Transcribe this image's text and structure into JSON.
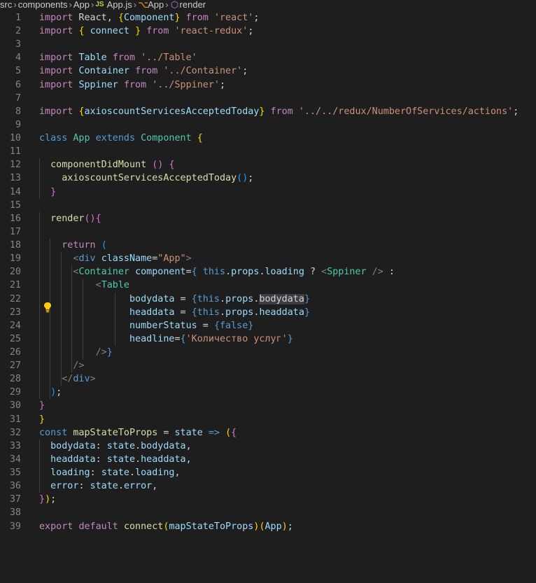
{
  "breadcrumb": {
    "segments": [
      "src",
      "components",
      "App",
      "App.js",
      "App",
      "render"
    ],
    "js_badge": "JS"
  },
  "lines": [
    {
      "n": "1",
      "t": [
        [
          "kw",
          "import"
        ],
        [
          "tx",
          " React, "
        ],
        [
          "br",
          "{"
        ],
        [
          "vr",
          "Component"
        ],
        [
          "br",
          "}"
        ],
        [
          "tx",
          " "
        ],
        [
          "kw",
          "from"
        ],
        [
          "tx",
          " "
        ],
        [
          "s",
          "'react'"
        ],
        [
          "tx",
          ";"
        ]
      ]
    },
    {
      "n": "2",
      "t": [
        [
          "kw",
          "import"
        ],
        [
          "tx",
          " "
        ],
        [
          "br",
          "{"
        ],
        [
          "tx",
          " "
        ],
        [
          "vr",
          "connect"
        ],
        [
          "tx",
          " "
        ],
        [
          "br",
          "}"
        ],
        [
          "tx",
          " "
        ],
        [
          "kw",
          "from"
        ],
        [
          "tx",
          " "
        ],
        [
          "s",
          "'react-redux'"
        ],
        [
          "tx",
          ";"
        ]
      ]
    },
    {
      "n": "3",
      "t": []
    },
    {
      "n": "4",
      "t": [
        [
          "kw",
          "import"
        ],
        [
          "tx",
          " "
        ],
        [
          "vr",
          "Table"
        ],
        [
          "tx",
          " "
        ],
        [
          "kw",
          "from"
        ],
        [
          "tx",
          " "
        ],
        [
          "s",
          "'../Table'"
        ]
      ]
    },
    {
      "n": "5",
      "t": [
        [
          "kw",
          "import"
        ],
        [
          "tx",
          " "
        ],
        [
          "vr",
          "Container"
        ],
        [
          "tx",
          " "
        ],
        [
          "kw",
          "from"
        ],
        [
          "tx",
          " "
        ],
        [
          "s",
          "'../Container'"
        ],
        [
          "tx",
          ";"
        ]
      ]
    },
    {
      "n": "6",
      "t": [
        [
          "kw",
          "import"
        ],
        [
          "tx",
          " "
        ],
        [
          "vr",
          "Sppiner"
        ],
        [
          "tx",
          " "
        ],
        [
          "kw",
          "from"
        ],
        [
          "tx",
          " "
        ],
        [
          "s",
          "'../Sppiner'"
        ],
        [
          "tx",
          ";"
        ]
      ]
    },
    {
      "n": "7",
      "t": []
    },
    {
      "n": "8",
      "t": [
        [
          "kw",
          "import"
        ],
        [
          "tx",
          " "
        ],
        [
          "br",
          "{"
        ],
        [
          "vr",
          "axioscountServicesAcceptedToday"
        ],
        [
          "br",
          "}"
        ],
        [
          "tx",
          " "
        ],
        [
          "kw",
          "from"
        ],
        [
          "tx",
          " "
        ],
        [
          "s",
          "'../../redux/NumberOfServices/actions'"
        ],
        [
          "tx",
          ";"
        ]
      ]
    },
    {
      "n": "9",
      "t": []
    },
    {
      "n": "10",
      "t": [
        [
          "st",
          "class"
        ],
        [
          "tx",
          " "
        ],
        [
          "cl",
          "App"
        ],
        [
          "tx",
          " "
        ],
        [
          "st",
          "extends"
        ],
        [
          "tx",
          " "
        ],
        [
          "cl",
          "Component"
        ],
        [
          "tx",
          " "
        ],
        [
          "br",
          "{"
        ]
      ]
    },
    {
      "n": "11",
      "t": []
    },
    {
      "n": "12",
      "t": [
        [
          "tx",
          "  "
        ],
        [
          "fn",
          "componentDidMount"
        ],
        [
          "tx",
          " "
        ],
        [
          "br2",
          "()"
        ],
        [
          "tx",
          " "
        ],
        [
          "br2",
          "{"
        ]
      ]
    },
    {
      "n": "13",
      "t": [
        [
          "tx",
          "    "
        ],
        [
          "fn",
          "axioscountServicesAcceptedToday"
        ],
        [
          "br3",
          "()"
        ],
        [
          "tx",
          ";"
        ]
      ]
    },
    {
      "n": "14",
      "t": [
        [
          "tx",
          "  "
        ],
        [
          "br2",
          "}"
        ]
      ]
    },
    {
      "n": "15",
      "t": []
    },
    {
      "n": "16",
      "t": [
        [
          "tx",
          "  "
        ],
        [
          "fn",
          "render"
        ],
        [
          "br2",
          "()"
        ],
        [
          "br2",
          "{"
        ]
      ]
    },
    {
      "n": "17",
      "t": []
    },
    {
      "n": "18",
      "t": [
        [
          "tx",
          "    "
        ],
        [
          "kw",
          "return"
        ],
        [
          "tx",
          " "
        ],
        [
          "br3",
          "("
        ]
      ]
    },
    {
      "n": "19",
      "t": [
        [
          "tx",
          "      "
        ],
        [
          "pt",
          "<"
        ],
        [
          "tg",
          "div"
        ],
        [
          "tx",
          " "
        ],
        [
          "at",
          "className"
        ],
        [
          "tx",
          "="
        ],
        [
          "s",
          "\"App\""
        ],
        [
          "pt",
          ">"
        ]
      ]
    },
    {
      "n": "20",
      "t": [
        [
          "tx",
          "      "
        ],
        [
          "pt",
          "<"
        ],
        [
          "cl",
          "Container"
        ],
        [
          "tx",
          " "
        ],
        [
          "at",
          "component"
        ],
        [
          "tx",
          "="
        ],
        [
          "st",
          "{"
        ],
        [
          "tx",
          " "
        ],
        [
          "st",
          "this"
        ],
        [
          "tx",
          "."
        ],
        [
          "vr",
          "props"
        ],
        [
          "tx",
          "."
        ],
        [
          "vr",
          "loading"
        ],
        [
          "tx",
          " ? "
        ],
        [
          "pt",
          "<"
        ],
        [
          "cl",
          "Sppiner"
        ],
        [
          "tx",
          " "
        ],
        [
          "pt",
          "/>"
        ],
        [
          "tx",
          " :"
        ]
      ]
    },
    {
      "n": "21",
      "t": [
        [
          "tx",
          "          "
        ],
        [
          "pt",
          "<"
        ],
        [
          "cl",
          "Table"
        ]
      ]
    },
    {
      "n": "22",
      "t": [
        [
          "tx",
          "                "
        ],
        [
          "at",
          "bodydata"
        ],
        [
          "tx",
          " = "
        ],
        [
          "st",
          "{"
        ],
        [
          "st",
          "this"
        ],
        [
          "tx",
          "."
        ],
        [
          "vr",
          "props"
        ],
        [
          "tx",
          "."
        ],
        [
          "sel",
          "bodydata"
        ],
        [
          "st",
          "}"
        ]
      ]
    },
    {
      "n": "23",
      "t": [
        [
          "tx",
          "                "
        ],
        [
          "at",
          "headdata"
        ],
        [
          "tx",
          " = "
        ],
        [
          "st",
          "{"
        ],
        [
          "st",
          "this"
        ],
        [
          "tx",
          "."
        ],
        [
          "vr",
          "props"
        ],
        [
          "tx",
          "."
        ],
        [
          "vr",
          "headdata"
        ],
        [
          "st",
          "}"
        ]
      ]
    },
    {
      "n": "24",
      "t": [
        [
          "tx",
          "                "
        ],
        [
          "at",
          "numberStatus"
        ],
        [
          "tx",
          " = "
        ],
        [
          "st",
          "{"
        ],
        [
          "st",
          "false"
        ],
        [
          "st",
          "}"
        ]
      ]
    },
    {
      "n": "25",
      "t": [
        [
          "tx",
          "                "
        ],
        [
          "at",
          "headline"
        ],
        [
          "tx",
          "="
        ],
        [
          "st",
          "{"
        ],
        [
          "s",
          "'Количество услуг'"
        ],
        [
          "st",
          "}"
        ]
      ]
    },
    {
      "n": "26",
      "t": [
        [
          "tx",
          "          "
        ],
        [
          "pt",
          "/>"
        ],
        [
          "st",
          "}"
        ]
      ]
    },
    {
      "n": "27",
      "t": [
        [
          "tx",
          "      "
        ],
        [
          "pt",
          "/>"
        ]
      ]
    },
    {
      "n": "28",
      "t": [
        [
          "tx",
          "    "
        ],
        [
          "pt",
          "</"
        ],
        [
          "tg",
          "div"
        ],
        [
          "pt",
          ">"
        ]
      ]
    },
    {
      "n": "29",
      "t": [
        [
          "tx",
          "  "
        ],
        [
          "br3",
          ")"
        ],
        [
          "tx",
          ";"
        ]
      ]
    },
    {
      "n": "30",
      "t": [
        [
          "br2",
          "}"
        ]
      ]
    },
    {
      "n": "31",
      "t": [
        [
          "br",
          "}"
        ]
      ]
    },
    {
      "n": "32",
      "t": [
        [
          "st",
          "const"
        ],
        [
          "tx",
          " "
        ],
        [
          "fn",
          "mapStateToProps"
        ],
        [
          "tx",
          " = "
        ],
        [
          "vr",
          "state"
        ],
        [
          "tx",
          " "
        ],
        [
          "st",
          "=>"
        ],
        [
          "tx",
          " "
        ],
        [
          "br",
          "("
        ],
        [
          "br2",
          "{"
        ]
      ]
    },
    {
      "n": "33",
      "t": [
        [
          "tx",
          "  "
        ],
        [
          "vr",
          "bodydata"
        ],
        [
          "tx",
          ": "
        ],
        [
          "vr",
          "state"
        ],
        [
          "tx",
          "."
        ],
        [
          "vr",
          "bodydata"
        ],
        [
          "tx",
          ","
        ]
      ]
    },
    {
      "n": "34",
      "t": [
        [
          "tx",
          "  "
        ],
        [
          "vr",
          "headdata"
        ],
        [
          "tx",
          ": "
        ],
        [
          "vr",
          "state"
        ],
        [
          "tx",
          "."
        ],
        [
          "vr",
          "headdata"
        ],
        [
          "tx",
          ","
        ]
      ]
    },
    {
      "n": "35",
      "t": [
        [
          "tx",
          "  "
        ],
        [
          "vr",
          "loading"
        ],
        [
          "tx",
          ": "
        ],
        [
          "vr",
          "state"
        ],
        [
          "tx",
          "."
        ],
        [
          "vr",
          "loading"
        ],
        [
          "tx",
          ","
        ]
      ]
    },
    {
      "n": "36",
      "t": [
        [
          "tx",
          "  "
        ],
        [
          "vr",
          "error"
        ],
        [
          "tx",
          ": "
        ],
        [
          "vr",
          "state"
        ],
        [
          "tx",
          "."
        ],
        [
          "vr",
          "error"
        ],
        [
          "tx",
          ","
        ]
      ]
    },
    {
      "n": "37",
      "t": [
        [
          "br2",
          "}"
        ],
        [
          "br",
          ")"
        ],
        [
          "tx",
          ";"
        ]
      ]
    },
    {
      "n": "38",
      "t": []
    },
    {
      "n": "39",
      "t": [
        [
          "kw",
          "export"
        ],
        [
          "tx",
          " "
        ],
        [
          "kw",
          "default"
        ],
        [
          "tx",
          " "
        ],
        [
          "fn",
          "connect"
        ],
        [
          "br",
          "("
        ],
        [
          "vr",
          "mapStateToProps"
        ],
        [
          "br",
          ")"
        ],
        [
          "br",
          "("
        ],
        [
          "vr",
          "App"
        ],
        [
          "br",
          ")"
        ],
        [
          "tx",
          ";"
        ]
      ]
    }
  ],
  "colors": {
    "background": "#1e1e1e",
    "line_number": "#858585",
    "keyword": "#c586c0",
    "storage": "#569cd6",
    "string": "#ce9178",
    "function": "#dcdcaa",
    "class": "#4ec9b0",
    "variable": "#9cdcfe"
  },
  "icons": {
    "lightbulb": "lightbulb-icon"
  }
}
